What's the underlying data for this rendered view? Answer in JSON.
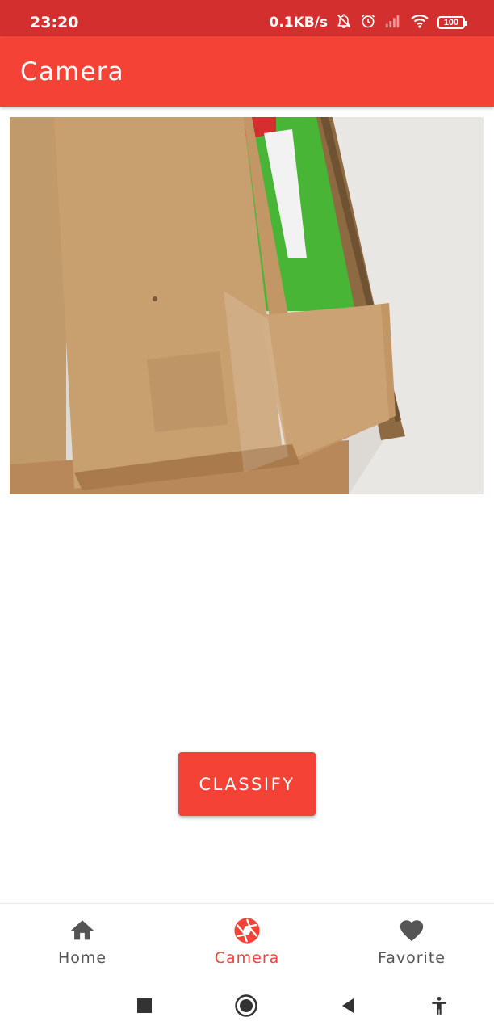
{
  "status_bar": {
    "time": "23:20",
    "net_speed": "0.1KB/s",
    "battery": "100",
    "icons": [
      "bell-off-icon",
      "alarm-icon",
      "signal-icon",
      "wifi-icon",
      "battery-icon"
    ]
  },
  "app_bar": {
    "title": "Camera"
  },
  "photo": {
    "icon": "cardboard-box-photo"
  },
  "actions": {
    "classify_label": "CLASSIFY"
  },
  "bottom_nav": {
    "items": [
      {
        "label": "Home",
        "icon": "home-icon"
      },
      {
        "label": "Camera",
        "icon": "camera-shutter-icon"
      },
      {
        "label": "Favorite",
        "icon": "heart-icon"
      }
    ],
    "active": "Camera"
  },
  "system_nav": {
    "icons": [
      "recents-icon",
      "home-circle-icon",
      "back-icon",
      "accessibility-icon"
    ]
  },
  "colors": {
    "primary": "#f44336",
    "status_bar": "#d32f2f",
    "nav_inactive": "#555555",
    "background": "#ffffff"
  }
}
